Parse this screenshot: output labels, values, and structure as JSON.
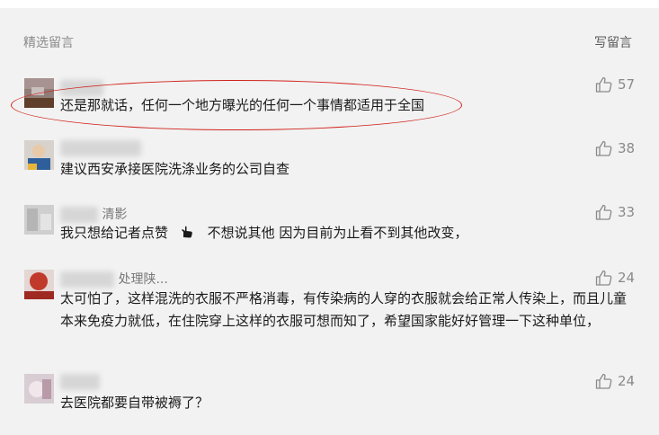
{
  "header": {
    "title": "精选留言",
    "write_label": "写留言"
  },
  "comments": [
    {
      "name": "",
      "text": "还是那就话，任何一个地方曝光的任何一个事情都适用于全国",
      "likes": "57"
    },
    {
      "name": "",
      "text": "建议西安承接医院洗涤业务的公司自查",
      "likes": "38"
    },
    {
      "name": "清影",
      "text_before": "我只想给记者点赞",
      "text_after": "不想说其他 因为目前为止看不到其他改变，",
      "likes": "33"
    },
    {
      "name": "处理陕...",
      "text": "太可怕了，这样混洗的衣服不严格消毒，有传染病的人穿的衣服就会给正常人传染上，而且儿童本来免疫力就低，在住院穿上这样的衣服可想而知了，希望国家能好好管理一下这种单位，",
      "likes": "24"
    },
    {
      "name": "",
      "text": "去医院都要自带被褥了？",
      "likes": "24"
    }
  ]
}
